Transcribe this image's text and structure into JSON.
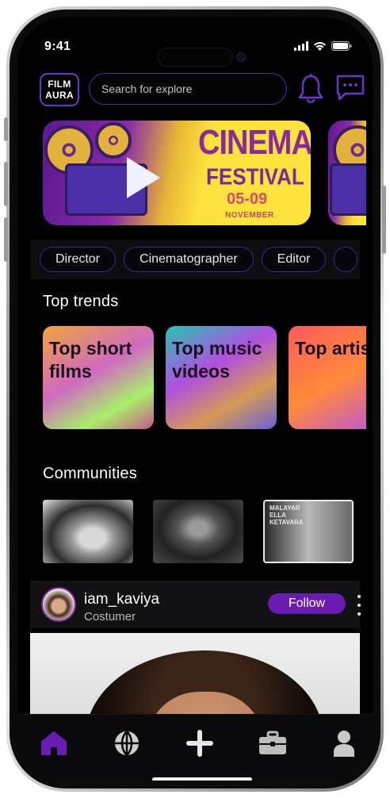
{
  "status": {
    "time": "9:41"
  },
  "header": {
    "logo_line1": "FILM",
    "logo_line2": "AURA",
    "search_placeholder": "Search for explore"
  },
  "banner": {
    "title": "CINEMA",
    "subtitle": "FESTIVAL",
    "date": "05-09",
    "month": "NOVEMBER"
  },
  "chips": [
    {
      "label": "Director"
    },
    {
      "label": "Cinematographer"
    },
    {
      "label": "Editor"
    }
  ],
  "trends": {
    "heading": "Top trends",
    "cards": [
      {
        "label": "Top short films"
      },
      {
        "label": "Top music videos"
      },
      {
        "label": "Top artists"
      }
    ]
  },
  "communities": {
    "heading": "Communities",
    "poster_text": "MALAYAR ELLA KETAVARA"
  },
  "post": {
    "username": "iam_kaviya",
    "role": "Costumer",
    "follow_label": "Follow"
  },
  "nav": {
    "items": [
      "home-icon",
      "globe-icon",
      "plus-icon",
      "briefcase-icon",
      "profile-icon"
    ],
    "active": "home-icon"
  },
  "colors": {
    "accent": "#6a1bb0",
    "border_purple": "#4f2fa3",
    "background": "#000000"
  }
}
